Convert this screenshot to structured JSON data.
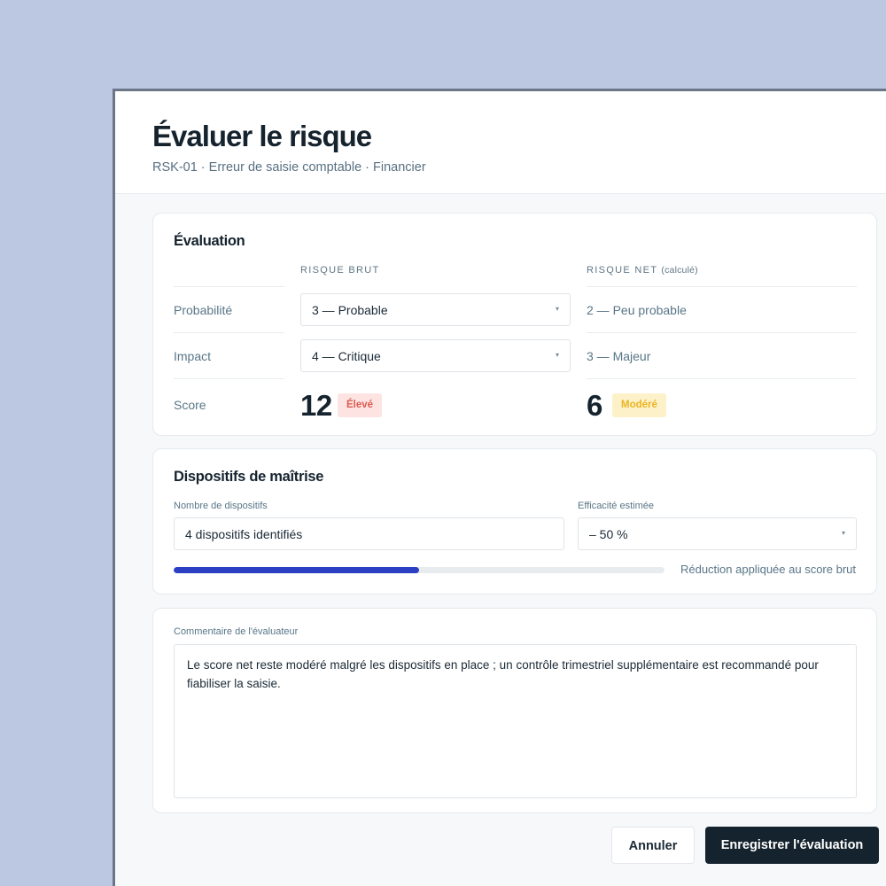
{
  "header": {
    "title": "Évaluer le risque",
    "subtitle": "RSK-01 · Erreur de saisie comptable · Financier"
  },
  "evaluation": {
    "title": "Évaluation",
    "col_gross": "RISQUE BRUT",
    "col_net": "RISQUE NET",
    "col_net_note": "(calculé)",
    "rows": {
      "probability": {
        "label": "Probabilité",
        "gross": "3 — Probable",
        "net": "2 — Peu probable"
      },
      "impact": {
        "label": "Impact",
        "gross": "4 — Critique",
        "net": "3 — Majeur"
      },
      "score": {
        "label": "Score",
        "gross_value": "12",
        "gross_badge": "Élevé",
        "net_value": "6",
        "net_badge": "Modéré"
      }
    }
  },
  "controls": {
    "title": "Dispositifs de maîtrise",
    "count_label": "Nombre de dispositifs",
    "count_value": "4 dispositifs identifiés",
    "efficiency_label": "Efficacité estimée",
    "efficiency_value": "– 50 %",
    "reduction_progress": 0.5,
    "reduction_note": "Réduction appliquée au score brut"
  },
  "comment": {
    "label": "Commentaire de l'évaluateur",
    "value": "Le score net reste modéré malgré les dispositifs en place ; un contrôle trimestriel supplémentaire est recommandé pour fiabiliser la saisie."
  },
  "actions": {
    "cancel": "Annuler",
    "save": "Enregistrer l'évaluation"
  },
  "icons": {
    "select_chevron": "▾"
  },
  "colors": {
    "accent": "#2a3fc2",
    "badge_high_bg": "#fde4e2",
    "badge_high_text": "#db5b52",
    "badge_moderate_bg": "#fdf1c9",
    "badge_moderate_text": "#eab522",
    "primary_button": "#15232e"
  }
}
